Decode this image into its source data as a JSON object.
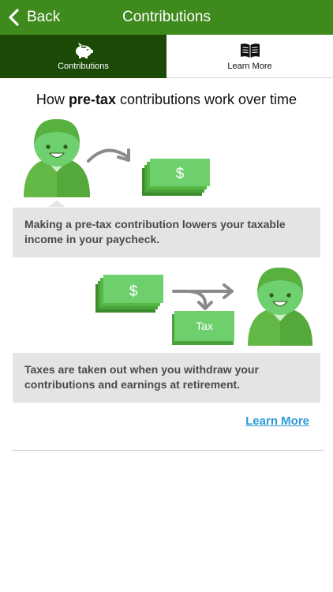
{
  "nav": {
    "back_label": "Back",
    "title": "Contributions"
  },
  "tabs": [
    {
      "label": "Contributions",
      "icon": "piggy-bank-icon",
      "active": true
    },
    {
      "label": "Learn More",
      "icon": "book-icon",
      "active": false
    }
  ],
  "heading": {
    "pre": "How ",
    "bold": "pre-tax",
    "post": " contributions work over time"
  },
  "illustration1": {
    "money_symbol": "$"
  },
  "caption1": "Making a pre-tax contribution lowers your taxable income in your paycheck.",
  "illustration2": {
    "money_symbol": "$",
    "tax_label": "Tax"
  },
  "caption2": "Taxes are taken out when you withdraw your contributions and earnings at retirement.",
  "learn_more_link": "Learn More",
  "colors": {
    "header_green": "#3f8a1c",
    "active_tab": "#1b4a07",
    "money_green": "#5bc85b",
    "link_blue": "#2d9ad6"
  }
}
